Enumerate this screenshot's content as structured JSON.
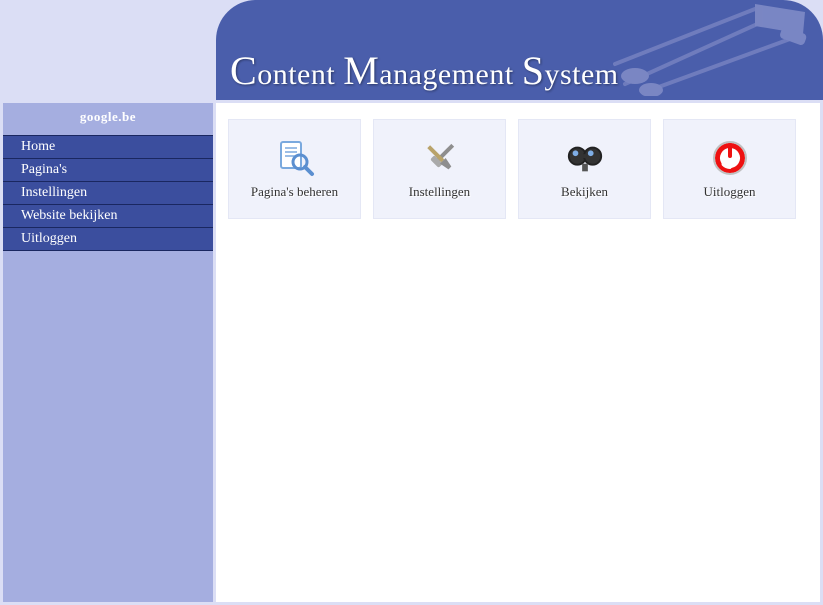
{
  "header": {
    "title_parts": [
      "C",
      "ontent ",
      "M",
      "anagement ",
      "S",
      "ystem"
    ]
  },
  "sidebar": {
    "title": "google.be",
    "items": [
      {
        "label": "Home"
      },
      {
        "label": "Pagina's"
      },
      {
        "label": "Instellingen"
      },
      {
        "label": "Website bekijken"
      },
      {
        "label": "Uitloggen"
      }
    ]
  },
  "tiles": [
    {
      "label": "Pagina's beheren",
      "icon": "manage-pages-icon"
    },
    {
      "label": "Instellingen",
      "icon": "settings-icon"
    },
    {
      "label": "Bekijken",
      "icon": "view-icon"
    },
    {
      "label": "Uitloggen",
      "icon": "logout-icon"
    }
  ]
}
